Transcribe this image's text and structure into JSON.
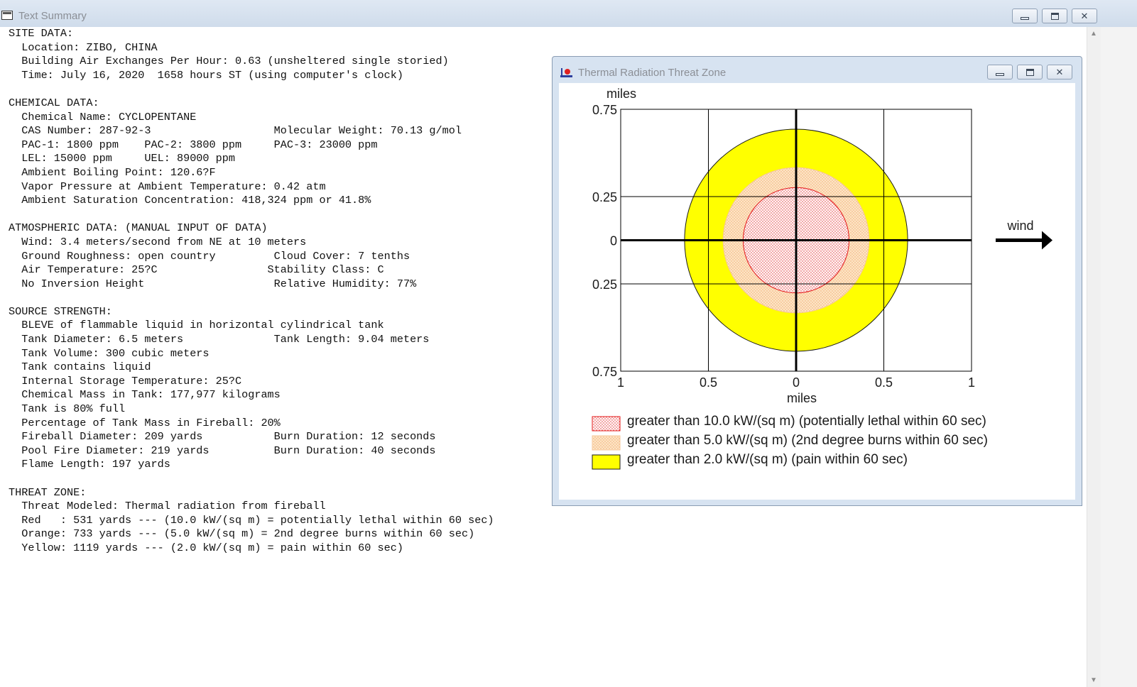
{
  "main_window": {
    "title": "Text Summary",
    "lines": [
      "SITE DATA:",
      "  Location: ZIBO, CHINA",
      "  Building Air Exchanges Per Hour: 0.63 (unsheltered single storied)",
      "  Time: July 16, 2020  1658 hours ST (using computer's clock)",
      "",
      "CHEMICAL DATA:",
      "  Chemical Name: CYCLOPENTANE",
      "  CAS Number: 287-92-3                   Molecular Weight: 70.13 g/mol",
      "  PAC-1: 1800 ppm    PAC-2: 3800 ppm     PAC-3: 23000 ppm",
      "  LEL: 15000 ppm     UEL: 89000 ppm",
      "  Ambient Boiling Point: 120.6?F",
      "  Vapor Pressure at Ambient Temperature: 0.42 atm",
      "  Ambient Saturation Concentration: 418,324 ppm or 41.8%",
      "",
      "ATMOSPHERIC DATA: (MANUAL INPUT OF DATA)",
      "  Wind: 3.4 meters/second from NE at 10 meters",
      "  Ground Roughness: open country         Cloud Cover: 7 tenths",
      "  Air Temperature: 25?C                 Stability Class: C",
      "  No Inversion Height                    Relative Humidity: 77%",
      "",
      "SOURCE STRENGTH:",
      "  BLEVE of flammable liquid in horizontal cylindrical tank",
      "  Tank Diameter: 6.5 meters              Tank Length: 9.04 meters",
      "  Tank Volume: 300 cubic meters",
      "  Tank contains liquid",
      "  Internal Storage Temperature: 25?C",
      "  Chemical Mass in Tank: 177,977 kilograms",
      "  Tank is 80% full",
      "  Percentage of Tank Mass in Fireball: 20%",
      "  Fireball Diameter: 209 yards           Burn Duration: 12 seconds",
      "  Pool Fire Diameter: 219 yards          Burn Duration: 40 seconds",
      "  Flame Length: 197 yards",
      "",
      "THREAT ZONE:",
      "  Threat Modeled: Thermal radiation from fireball",
      "  Red   : 531 yards --- (10.0 kW/(sq m) = potentially lethal within 60 sec)",
      "  Orange: 733 yards --- (5.0 kW/(sq m) = 2nd degree burns within 60 sec)",
      "  Yellow: 1119 yards --- (2.0 kW/(sq m) = pain within 60 sec)"
    ]
  },
  "threat_window": {
    "title": "Thermal Radiation Threat Zone",
    "wind_label": "wind"
  },
  "chart_data": {
    "type": "scatter",
    "xlabel": "miles",
    "ylabel": "miles",
    "xlim": [
      -1,
      1
    ],
    "ylim": [
      -0.75,
      0.75
    ],
    "x_tick_labels": [
      "1",
      "0.5",
      "0",
      "0.5",
      "1"
    ],
    "x_tick_values": [
      -1,
      -0.5,
      0,
      0.5,
      1
    ],
    "y_tick_labels": [
      "0.75",
      "0.25",
      "0",
      "0.25",
      "0.75"
    ],
    "y_tick_values": [
      0.75,
      0.25,
      0,
      -0.25,
      -0.75
    ],
    "grid": true,
    "zones": [
      {
        "name": "greater than 2.0 kW/(sq m) (pain within 60 sec)",
        "radius_miles": 0.636,
        "fill": "#ffff00",
        "stroke": "#000000"
      },
      {
        "name": "greater than 5.0 kW/(sq m) (2nd degree burns within 60 sec)",
        "radius_miles": 0.416,
        "fill": "#fde0b8",
        "stroke": "#f4b183"
      },
      {
        "name": "greater than 10.0 kW/(sq m) (potentially lethal within 60 sec)",
        "radius_miles": 0.302,
        "fill": "#fff2f2",
        "stroke": "#e41b1b"
      }
    ],
    "legend": [
      {
        "label": "greater than 10.0 kW/(sq m) (potentially lethal within 60 sec)",
        "color": "#e41b1b"
      },
      {
        "label": "greater than 5.0 kW/(sq m) (2nd degree burns within 60 sec)",
        "color": "#f4b183"
      },
      {
        "label": "greater than 2.0 kW/(sq m) (pain within 60 sec)",
        "color": "#ffff00"
      }
    ]
  }
}
